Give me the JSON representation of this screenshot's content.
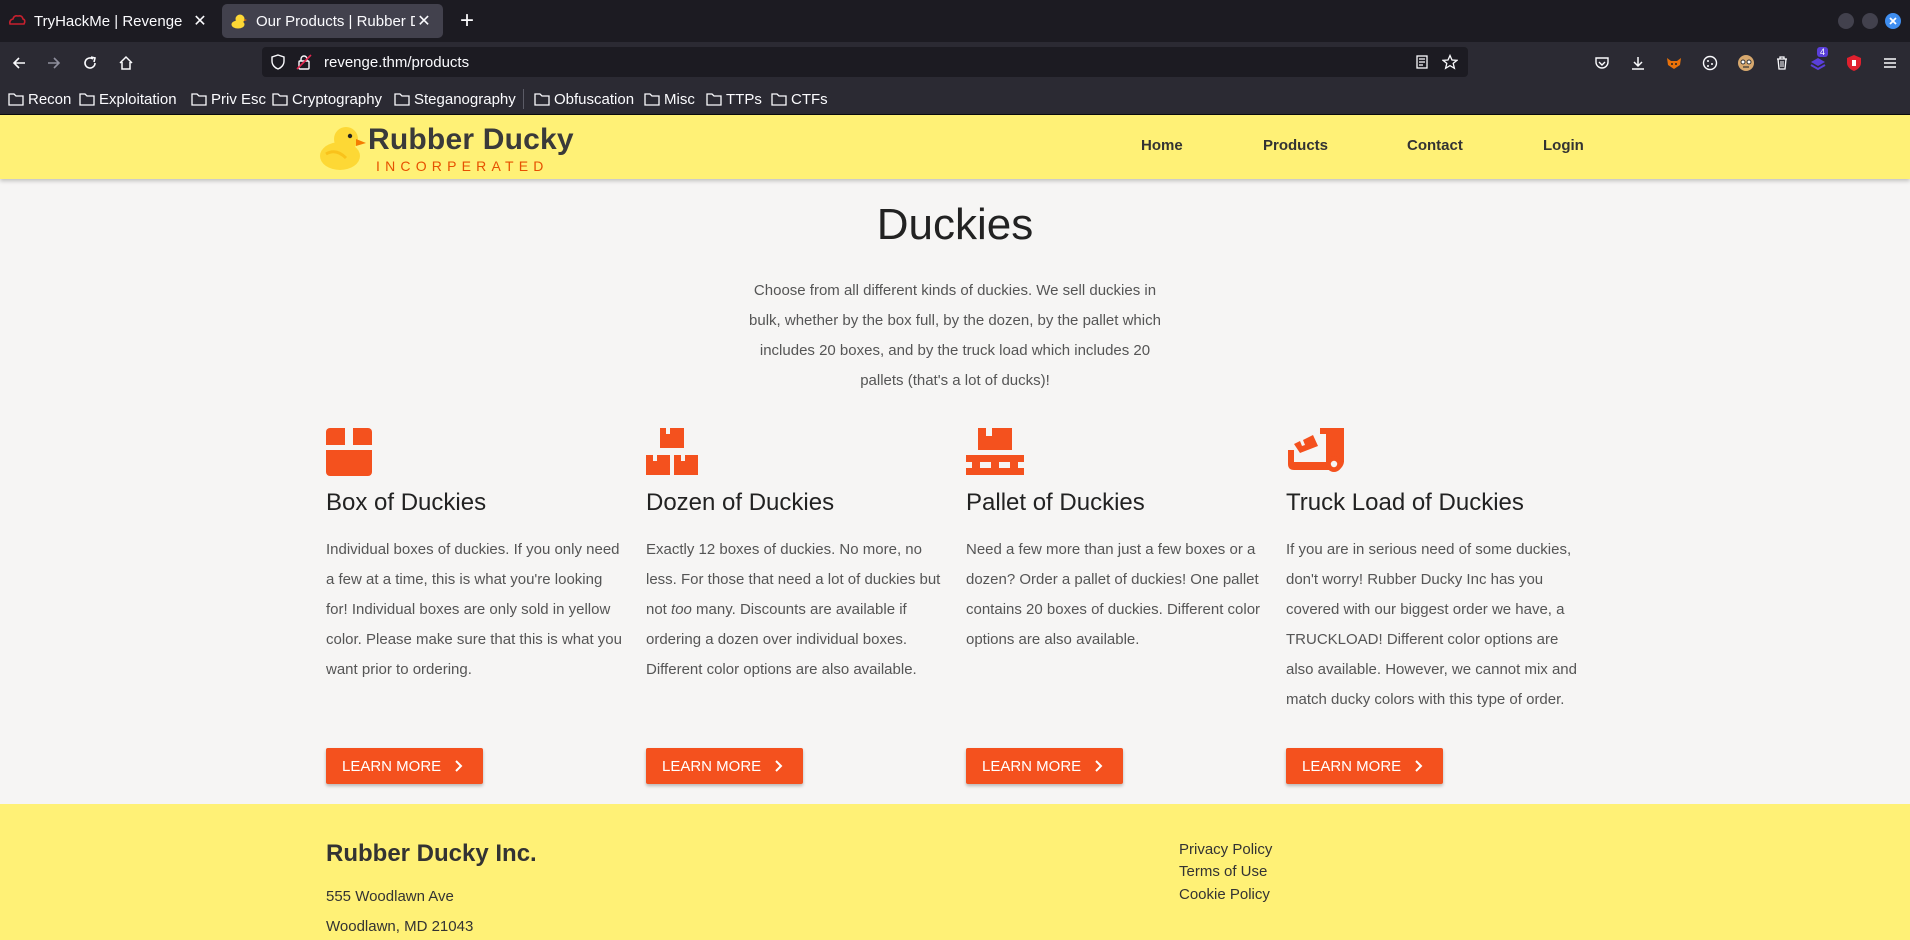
{
  "browser": {
    "tabs": [
      {
        "title": "TryHackMe | Revenge",
        "active": false
      },
      {
        "title": "Our Products | Rubber Du",
        "active": true
      }
    ],
    "url": "revenge.thm/products",
    "bookmarks": [
      "Recon",
      "Exploitation",
      "Priv Esc",
      "Cryptography",
      "Steganography",
      "Obfuscation",
      "Misc",
      "TTPs",
      "CTFs"
    ],
    "extension_badge": "4"
  },
  "site": {
    "logo": {
      "name": "Rubber Ducky",
      "tagline": "INCORPERATED"
    },
    "nav": [
      "Home",
      "Products",
      "Contact",
      "Login"
    ]
  },
  "main": {
    "title": "Duckies",
    "intro": "Choose from all different kinds of duckies. We sell duckies in bulk, whether by the box full, by the dozen, by the pallet which includes 20 boxes, and by the truck load which includes 20 pallets (that's a lot of ducks)!",
    "products": [
      {
        "icon": "box-icon",
        "title": "Box of Duckies",
        "desc": "Individual boxes of duckies. If you only need a few at a time, this is what you're looking for! Individual boxes are only sold in yellow color. Please make sure that this is what you want prior to ordering.",
        "button": "LEARN MORE"
      },
      {
        "icon": "boxes-icon",
        "title": "Dozen of Duckies",
        "desc_before": "Exactly 12 boxes of duckies. No more, no less. For those that need a lot of duckies but not ",
        "desc_em": "too",
        "desc_after": " many. Discounts are available if ordering a dozen over individual boxes. Different color options are also available.",
        "button": "LEARN MORE"
      },
      {
        "icon": "pallet-icon",
        "title": "Pallet of Duckies",
        "desc": "Need a few more than just a few boxes or a dozen? Order a pallet of duckies! One pallet contains 20 boxes of duckies. Different color options are also available.",
        "button": "LEARN MORE"
      },
      {
        "icon": "dolly-icon",
        "title": "Truck Load of Duckies",
        "desc": "If you are in serious need of some duckies, don't worry! Rubber Ducky Inc has you covered with our biggest order we have, a TRUCKLOAD! Different color options are also available. However, we cannot mix and match ducky colors with this type of order.",
        "button": "LEARN MORE"
      }
    ]
  },
  "footer": {
    "company": "Rubber Ducky Inc.",
    "address1": "555 Woodlawn Ave",
    "address2": "Woodlawn, MD 21043",
    "links": [
      "Privacy Policy",
      "Terms of Use",
      "Cookie Policy"
    ]
  },
  "colors": {
    "header_bg": "#fff176",
    "accent": "#f4511e",
    "page_bg": "#f6f5f4",
    "tagline": "#e65100"
  }
}
